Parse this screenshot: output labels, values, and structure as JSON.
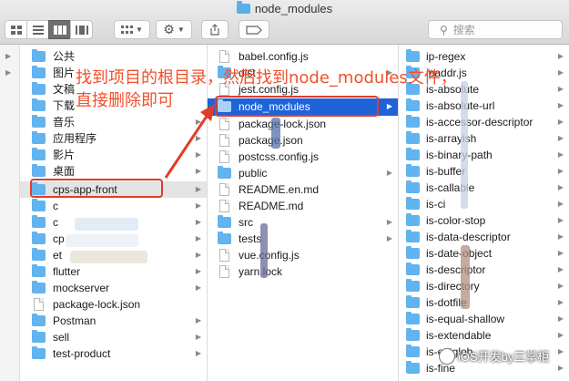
{
  "window": {
    "title": "node_modules",
    "search_placeholder": "搜索"
  },
  "columns": {
    "col1": [
      "公共",
      "图片",
      "文稿",
      "下载",
      "音乐",
      "应用程序",
      "影片",
      "桌面",
      "cps-app-front",
      "c",
      "c",
      "cp",
      "et",
      "flutter",
      "mockserver",
      "package-lock.json",
      "Postman",
      "sell",
      "test-product"
    ],
    "col2": [
      "babel.config.js",
      "dist",
      "jest.config.js",
      "node_modules",
      "package-lock.json",
      "package.json",
      "postcss.config.js",
      "public",
      "README.en.md",
      "README.md",
      "src",
      "tests",
      "vue.config.js",
      "yarn.lock"
    ],
    "col3": [
      "ip-regex",
      "ipaddr.js",
      "is-absolute",
      "is-absolute-url",
      "is-accessor-descriptor",
      "is-arrayish",
      "is-binary-path",
      "is-buffer",
      "is-callable",
      "is-ci",
      "is-color-stop",
      "is-data-descriptor",
      "is-date-object",
      "is-descriptor",
      "is-directory",
      "is-dotfile",
      "is-equal-shallow",
      "is-extendable",
      "is-extglob",
      "is-fine"
    ]
  },
  "selected": {
    "col1": "cps-app-front",
    "col2": "node_modules"
  },
  "annotation": {
    "line1": "找到项目的根目录，然后找到node_modules文件，",
    "line2": "直接删除即可"
  },
  "watermark": "iOS开发by三掌柜",
  "colors": {
    "selection": "#1f63d8",
    "annotation": "#f0502a",
    "folder": "#62b3ee"
  }
}
